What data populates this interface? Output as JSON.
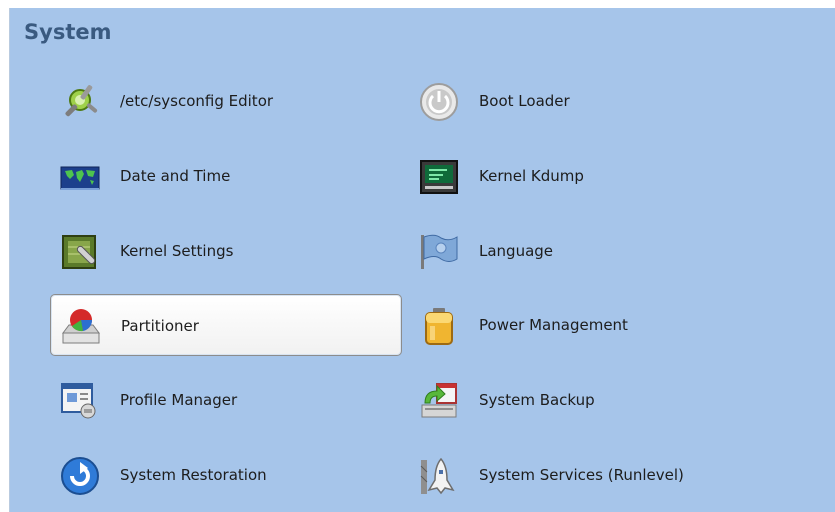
{
  "section": {
    "title": "System"
  },
  "items": [
    {
      "label": "/etc/sysconfig Editor",
      "icon": "sysconfig-editor-icon"
    },
    {
      "label": "Boot Loader",
      "icon": "boot-loader-icon"
    },
    {
      "label": "Date and Time",
      "icon": "world-map-icon"
    },
    {
      "label": "Kernel Kdump",
      "icon": "kdump-monitor-icon"
    },
    {
      "label": "Kernel Settings",
      "icon": "kernel-settings-icon"
    },
    {
      "label": "Language",
      "icon": "flag-icon"
    },
    {
      "label": "Partitioner",
      "icon": "partitioner-icon",
      "selected": true
    },
    {
      "label": "Power Management",
      "icon": "battery-icon"
    },
    {
      "label": "Profile Manager",
      "icon": "profile-manager-icon"
    },
    {
      "label": "System Backup",
      "icon": "system-backup-icon"
    },
    {
      "label": "System Restoration",
      "icon": "restore-icon"
    },
    {
      "label": "System Services (Runlevel)",
      "icon": "shuttle-icon"
    }
  ]
}
